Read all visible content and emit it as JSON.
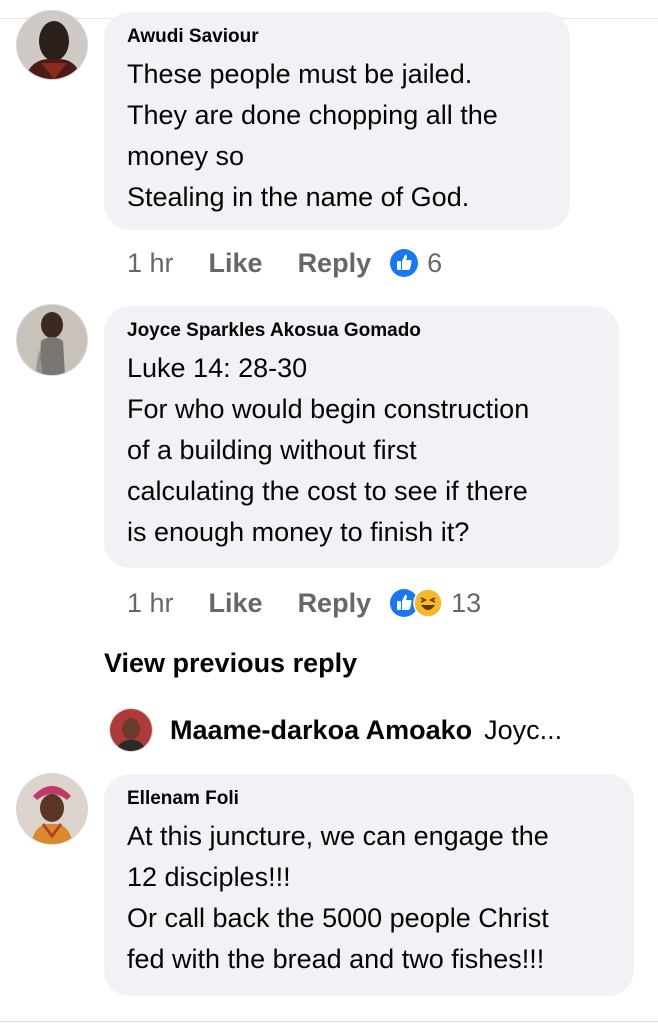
{
  "comments": [
    {
      "author": "Awudi Saviour",
      "lines": [
        "These people must be jailed.",
        "They are done chopping all the",
        "money so",
        "Stealing in the name of God."
      ],
      "time": "1 hr",
      "like_label": "Like",
      "reply_label": "Reply",
      "reactions": [
        "like-reaction-icon"
      ],
      "reaction_count": "6"
    },
    {
      "author": "Joyce Sparkles Akosua Gomado",
      "lines": [
        "Luke 14: 28-30",
        "For who would begin construction",
        "of a building without first",
        "calculating the cost to see if there",
        "is enough money to finish it?"
      ],
      "time": "1 hr",
      "like_label": "Like",
      "reply_label": "Reply",
      "reactions": [
        "like-reaction-icon",
        "haha-reaction-icon"
      ],
      "reaction_count": "13"
    },
    {
      "author": "Ellenam Foli",
      "lines": [
        "At this juncture, we can engage the",
        "12 disciples!!!",
        "Or call back the 5000 people Christ",
        "fed with the bread and two fishes!!!"
      ]
    }
  ],
  "view_previous_reply": "View previous reply",
  "reply_preview": {
    "author": "Maame-darkoa Amoako",
    "text": "Joyc..."
  },
  "colors": {
    "bubble": "#f0f2f5",
    "meta_text": "#65676b",
    "like_blue": "#1877f2",
    "haha_yellow": "#f7b928"
  }
}
